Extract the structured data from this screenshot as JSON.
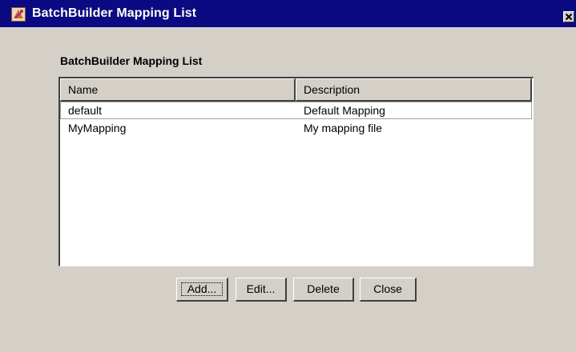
{
  "window": {
    "title": "BatchBuilder Mapping List",
    "title_icon": "app-icon",
    "close_icon": "close-icon"
  },
  "group": {
    "label": "BatchBuilder Mapping List"
  },
  "table": {
    "columns": [
      "Name",
      "Description"
    ],
    "rows": [
      {
        "name": "default",
        "description": "Default Mapping",
        "selected": true
      },
      {
        "name": "MyMapping",
        "description": "My mapping file",
        "selected": false
      }
    ]
  },
  "buttons": {
    "add": "Add...",
    "edit": "Edit...",
    "delete": "Delete",
    "close": "Close"
  },
  "colors": {
    "titlebar": "#0b0a82",
    "face": "#d4d0c8"
  }
}
